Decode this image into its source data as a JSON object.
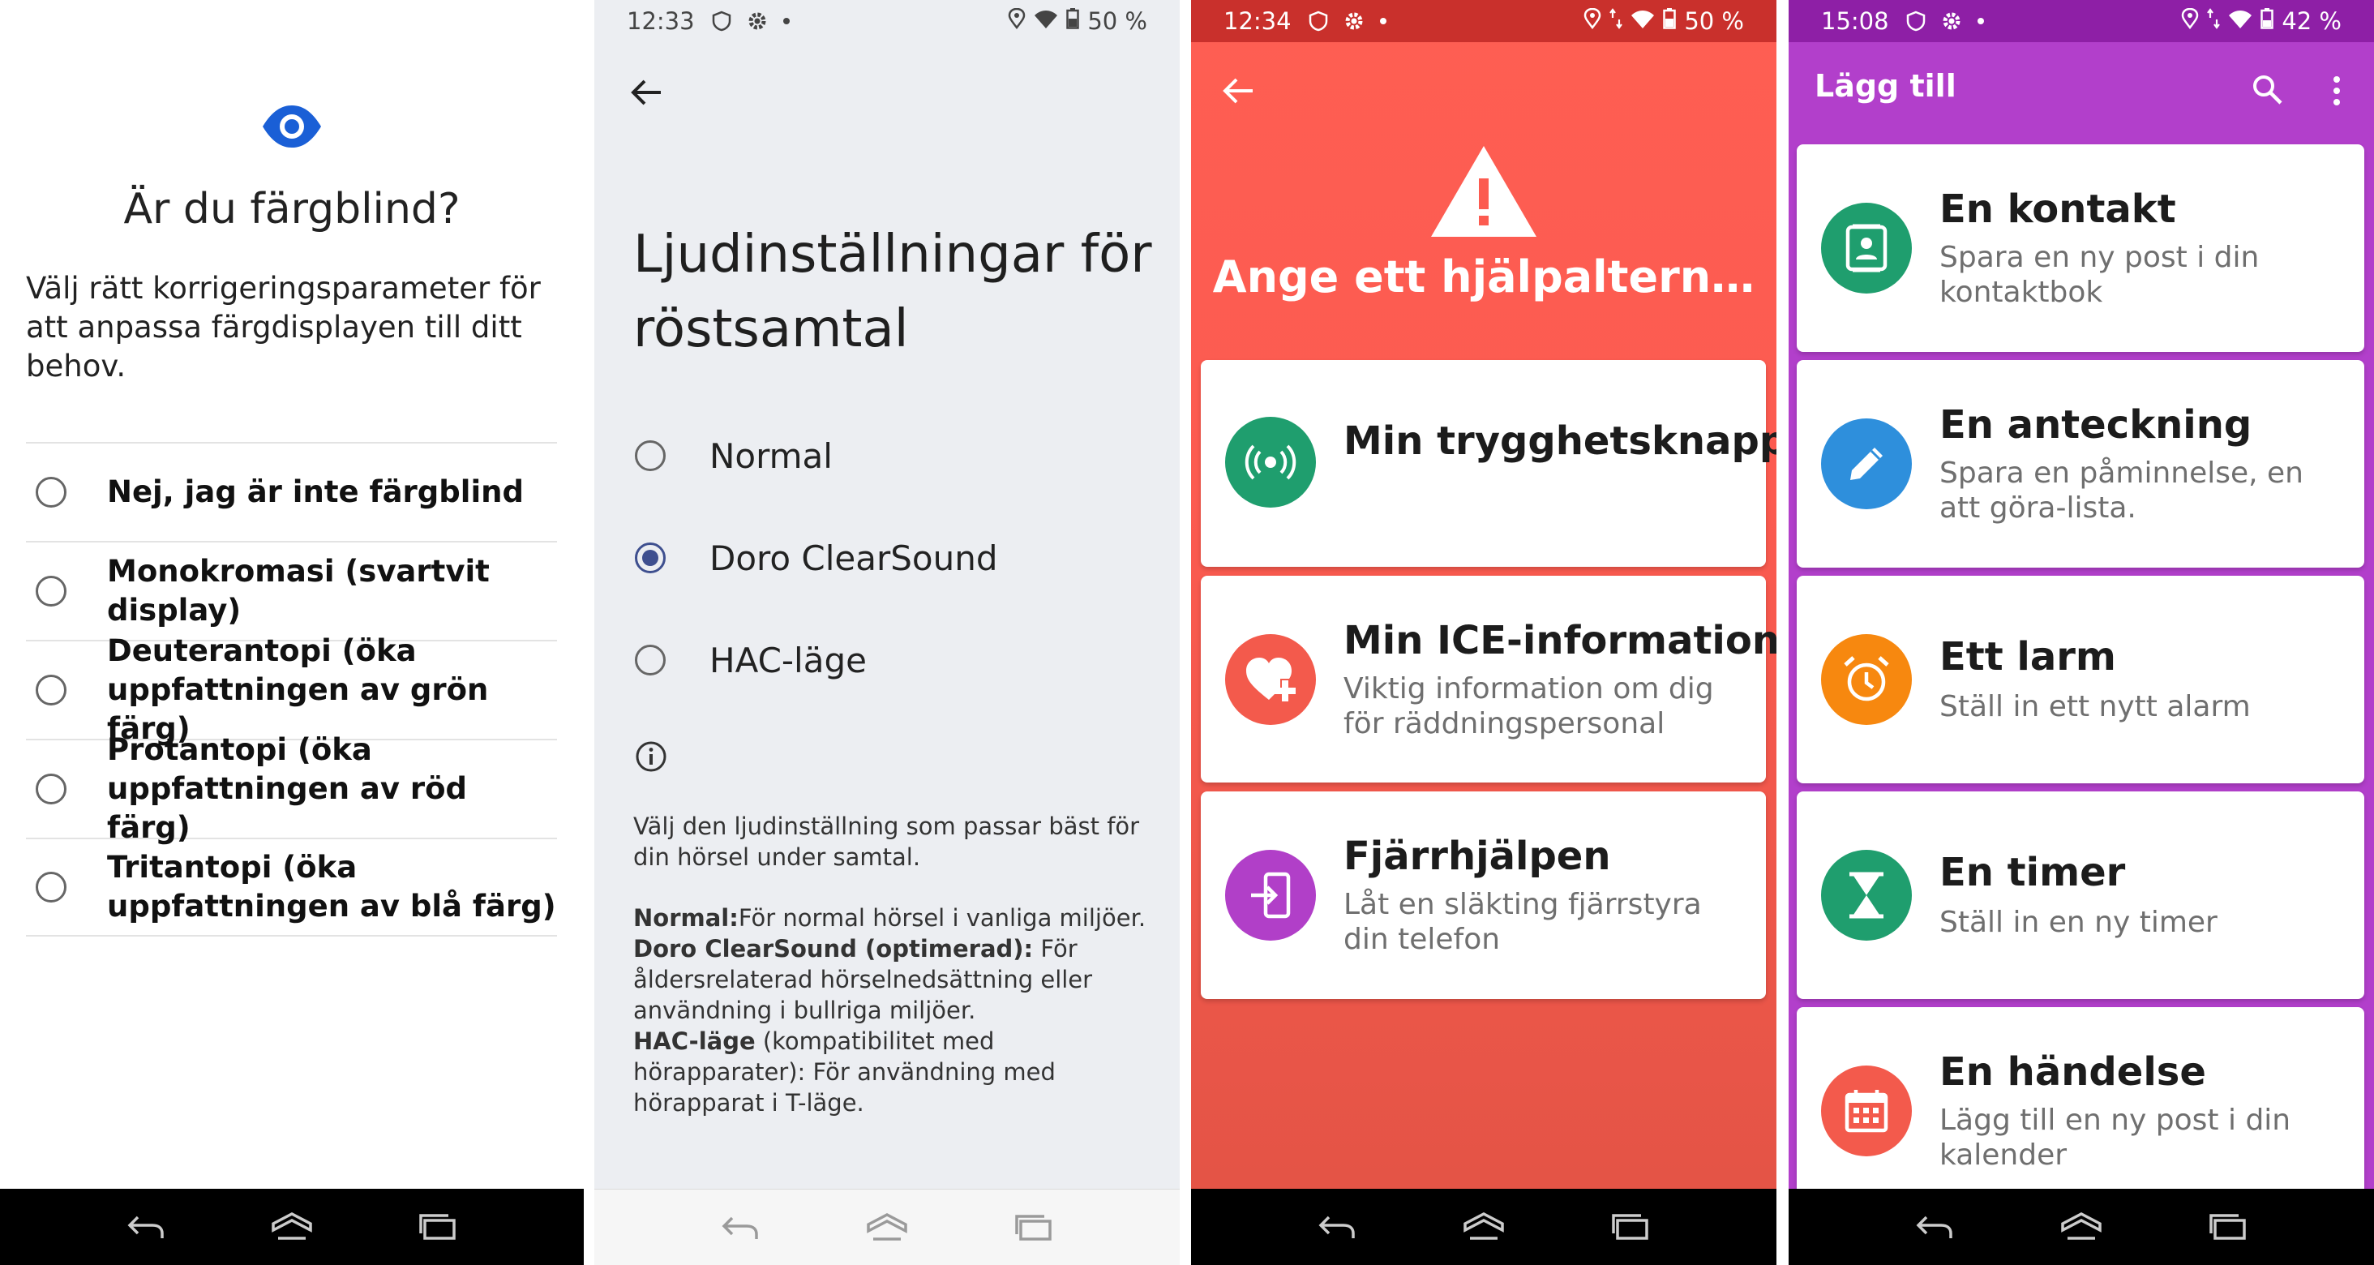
{
  "panel1": {
    "title": "Är du färgblind?",
    "description": "Välj rätt korrigeringsparameter för att anpassa färgdisplayen till ditt behov.",
    "options": [
      {
        "label": "Nej, jag är inte färgblind",
        "selected": false
      },
      {
        "label": "Monokromasi (svartvit display)",
        "selected": false
      },
      {
        "label": "Deuterantopi (öka uppfattningen av grön färg)",
        "selected": false
      },
      {
        "label": "Protantopi (öka uppfattningen av röd färg)",
        "selected": false
      },
      {
        "label": "Tritantopi (öka uppfattningen av blå färg)",
        "selected": false
      }
    ],
    "accent": "#1a5fd6"
  },
  "panel2": {
    "status": {
      "time": "12:33",
      "battery": "50 %"
    },
    "title": "Ljudinställningar för röstsamtal",
    "options": [
      {
        "label": "Normal",
        "selected": false
      },
      {
        "label": "Doro ClearSound",
        "selected": true
      },
      {
        "label": "HAC-läge",
        "selected": false
      }
    ],
    "info_intro": "Välj den ljudinställning som passar bäst för din hörsel under samtal.",
    "info_items": [
      {
        "term": "Normal:",
        "text": "För normal hörsel i vanliga miljöer."
      },
      {
        "term": "Doro ClearSound (optimerad):",
        "text": " För åldersrelaterad hörselnedsättning eller användning i bullriga miljöer."
      },
      {
        "term": "HAC-läge",
        "text": " (kompatibilitet med hörapparater): För användning med hörapparat i T-läge."
      }
    ]
  },
  "panel3": {
    "status": {
      "time": "12:34",
      "battery": "50 %"
    },
    "title": "Ange ett hjälpaltern…",
    "cards": [
      {
        "title": "Min trygghetsknapp",
        "subtitle": "",
        "icon": "broadcast-icon",
        "color": "#1f9e6e"
      },
      {
        "title": "Min ICE-information",
        "subtitle": "Viktig information om dig för räddningspersonal",
        "icon": "heart-plus-icon",
        "color": "#f35a4c"
      },
      {
        "title": "Fjärrhjälpen",
        "subtitle": "Låt en släkting fjärrstyra din telefon",
        "icon": "remote-login-icon",
        "color": "#b13fc8"
      }
    ]
  },
  "panel4": {
    "status": {
      "time": "15:08",
      "battery": "42 %"
    },
    "title": "Lägg till",
    "items": [
      {
        "title": "En kontakt",
        "subtitle": "Spara en ny post i din kontaktbok",
        "icon": "contact-icon",
        "color": "#1f9e6e"
      },
      {
        "title": "En anteckning",
        "subtitle": "Spara en påminnelse, en att göra-lista.",
        "icon": "pencil-icon",
        "color": "#2e8fdc"
      },
      {
        "title": "Ett larm",
        "subtitle": "Ställ in ett nytt alarm",
        "icon": "alarm-clock-icon",
        "color": "#f7880f"
      },
      {
        "title": "En timer",
        "subtitle": "Ställ in en ny timer",
        "icon": "hourglass-icon",
        "color": "#1f9e6e"
      },
      {
        "title": "En händelse",
        "subtitle": "Lägg till en ny post i din kalender",
        "icon": "calendar-icon",
        "color": "#f35a4c"
      }
    ]
  }
}
